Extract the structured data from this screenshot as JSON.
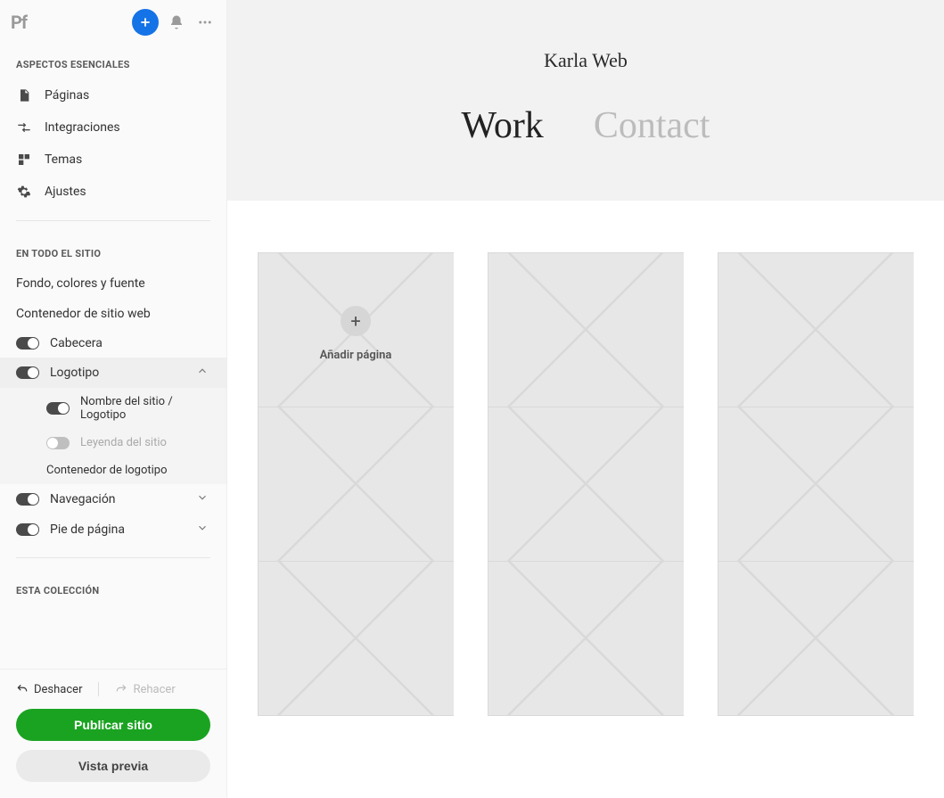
{
  "header": {
    "logo_text": "Pf"
  },
  "sidebar": {
    "sections": {
      "essentials_header": "ASPECTOS ESENCIALES",
      "sitewide_header": "EN TODO EL SITIO",
      "collection_header": "ESTA COLECCIÓN"
    },
    "essentials": {
      "pages": "Páginas",
      "integrations": "Integraciones",
      "themes": "Temas",
      "settings": "Ajustes"
    },
    "sitewide": {
      "bg_colors_font": "Fondo, colores y fuente",
      "site_container": "Contenedor de sitio web",
      "header": {
        "label": "Cabecera",
        "on": true
      },
      "logo": {
        "label": "Logotipo",
        "on": true,
        "expanded": true,
        "children": {
          "site_name_logo": {
            "label": "Nombre del sitio / Logotipo",
            "on": true
          },
          "site_caption": {
            "label": "Leyenda del sitio",
            "on": false
          },
          "logo_container": "Contenedor de logotipo"
        }
      },
      "navigation": {
        "label": "Navegación",
        "on": true
      },
      "footer": {
        "label": "Pie de página",
        "on": true
      }
    }
  },
  "bottom": {
    "undo": "Deshacer",
    "redo": "Rehacer",
    "publish": "Publicar sitio",
    "preview": "Vista previa"
  },
  "canvas": {
    "site_title": "Karla Web",
    "nav": {
      "work": "Work",
      "contact": "Contact"
    },
    "add_page_label": "Añadir página"
  }
}
